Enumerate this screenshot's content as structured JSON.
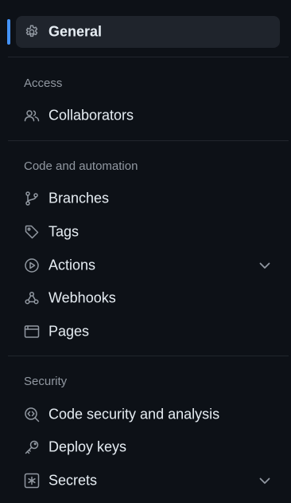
{
  "general": {
    "label": "General",
    "icon": "gear-icon"
  },
  "sections": {
    "access": {
      "title": "Access",
      "items": [
        {
          "label": "Collaborators",
          "icon": "people-icon"
        }
      ]
    },
    "code": {
      "title": "Code and automation",
      "items": [
        {
          "label": "Branches",
          "icon": "git-branch-icon"
        },
        {
          "label": "Tags",
          "icon": "tag-icon"
        },
        {
          "label": "Actions",
          "icon": "play-icon",
          "expandable": true
        },
        {
          "label": "Webhooks",
          "icon": "webhook-icon"
        },
        {
          "label": "Pages",
          "icon": "browser-icon"
        }
      ]
    },
    "security": {
      "title": "Security",
      "items": [
        {
          "label": "Code security and analysis",
          "icon": "codescan-icon"
        },
        {
          "label": "Deploy keys",
          "icon": "key-icon"
        },
        {
          "label": "Secrets",
          "icon": "asterisk-icon",
          "expandable": true
        }
      ]
    }
  },
  "colors": {
    "background": "#0d1117",
    "selected_bg": "#1f242c",
    "accent": "#4493f8",
    "text": "#e6edf3",
    "muted": "#9198a1",
    "divider": "#21262d"
  }
}
